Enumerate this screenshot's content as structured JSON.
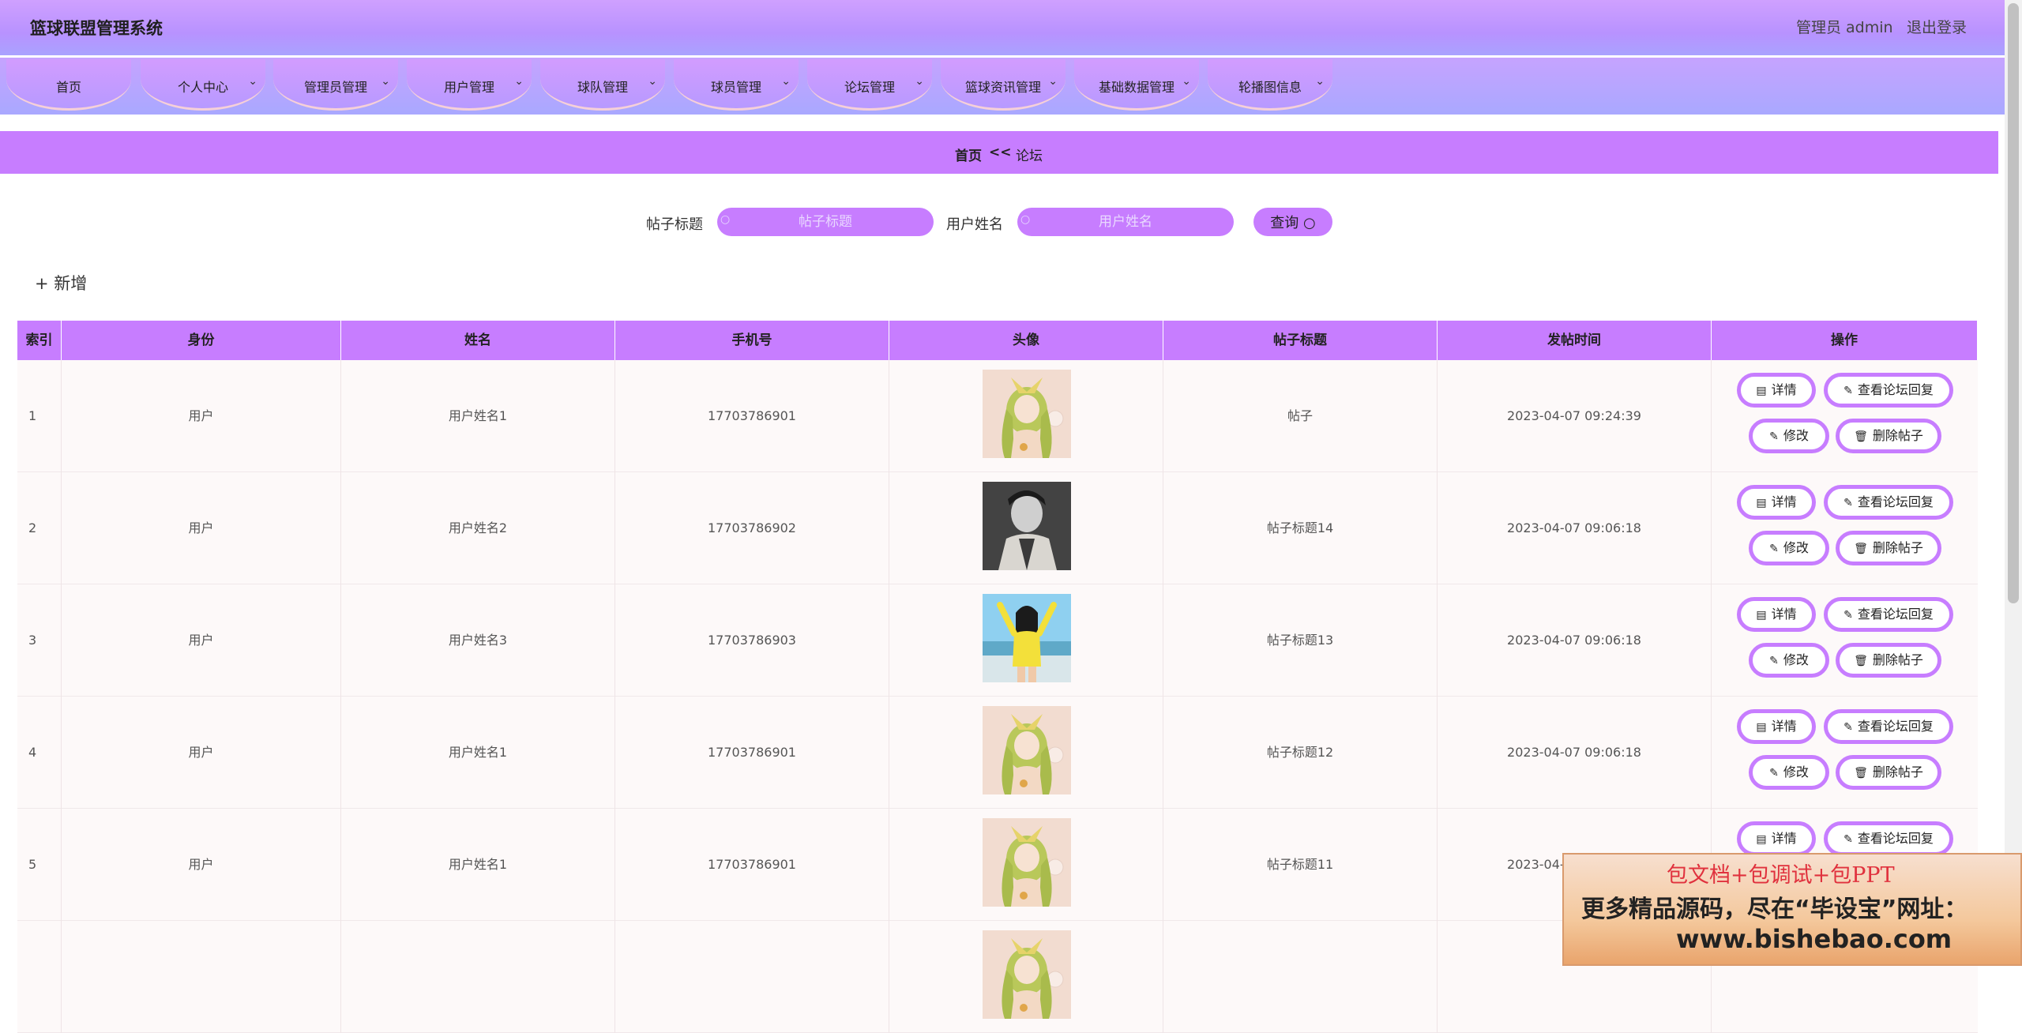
{
  "header": {
    "title": "篮球联盟管理系统",
    "admin_label": "管理员 admin",
    "logout": "退出登录"
  },
  "nav": [
    {
      "label": "首页",
      "has_dropdown": false
    },
    {
      "label": "个人中心",
      "has_dropdown": true
    },
    {
      "label": "管理员管理",
      "has_dropdown": true
    },
    {
      "label": "用户管理",
      "has_dropdown": true
    },
    {
      "label": "球队管理",
      "has_dropdown": true
    },
    {
      "label": "球员管理",
      "has_dropdown": true
    },
    {
      "label": "论坛管理",
      "has_dropdown": true
    },
    {
      "label": "篮球资讯管理",
      "has_dropdown": true
    },
    {
      "label": "基础数据管理",
      "has_dropdown": true
    },
    {
      "label": "轮播图信息",
      "has_dropdown": true
    }
  ],
  "breadcrumb": {
    "home": "首页",
    "separator": "<<",
    "current": "论坛"
  },
  "search": {
    "title_label": "帖子标题",
    "title_placeholder": "帖子标题",
    "name_label": "用户姓名",
    "name_placeholder": "用户姓名",
    "query_button": "查询"
  },
  "add_button": "新增",
  "table": {
    "headers": [
      "索引",
      "身份",
      "姓名",
      "手机号",
      "头像",
      "帖子标题",
      "发帖时间",
      "操作"
    ],
    "rows": [
      {
        "index": "1",
        "role": "用户",
        "name": "用户姓名1",
        "phone": "17703786901",
        "avatar": "anime-girl",
        "title": "帖子",
        "time": "2023-04-07 09:24:39"
      },
      {
        "index": "2",
        "role": "用户",
        "name": "用户姓名2",
        "phone": "17703786902",
        "avatar": "man-portrait",
        "title": "帖子标题14",
        "time": "2023-04-07 09:06:18"
      },
      {
        "index": "3",
        "role": "用户",
        "name": "用户姓名3",
        "phone": "17703786903",
        "avatar": "beach-girl",
        "title": "帖子标题13",
        "time": "2023-04-07 09:06:18"
      },
      {
        "index": "4",
        "role": "用户",
        "name": "用户姓名1",
        "phone": "17703786901",
        "avatar": "anime-girl",
        "title": "帖子标题12",
        "time": "2023-04-07 09:06:18"
      },
      {
        "index": "5",
        "role": "用户",
        "name": "用户姓名1",
        "phone": "17703786901",
        "avatar": "anime-girl",
        "title": "帖子标题11",
        "time": "2023-04-07 09:06:18"
      },
      {
        "index": "",
        "role": "",
        "name": "",
        "phone": "",
        "avatar": "anime-girl",
        "title": "",
        "time": ""
      }
    ],
    "actions": {
      "detail": "详情",
      "view_replies": "查看论坛回复",
      "edit": "修改",
      "delete": "删除帖子"
    }
  },
  "ad": {
    "line1": "包文档+包调试+包PPT",
    "line2": "更多精品源码，尽在“毕设宝”网址：",
    "line3": "www.bishebao.com"
  },
  "colors": {
    "accent": "#c77dff",
    "header_top": "#cfa0ff",
    "header_bottom": "#a9a2ff"
  }
}
